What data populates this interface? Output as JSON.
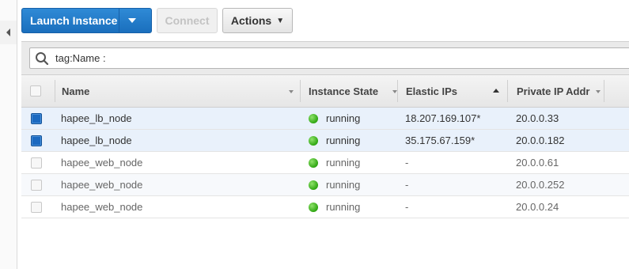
{
  "toolbar": {
    "launch_label": "Launch Instance",
    "connect_label": "Connect",
    "actions_label": "Actions"
  },
  "search": {
    "value": "tag:Name :"
  },
  "table": {
    "headers": {
      "name": "Name",
      "state": "Instance State",
      "elastic_ips": "Elastic IPs",
      "private_ip": "Private IP Addr"
    },
    "rows": [
      {
        "selected": true,
        "name": "hapee_lb_node",
        "state": "running",
        "elastic_ip": "18.207.169.107*",
        "private_ip": "20.0.0.33"
      },
      {
        "selected": true,
        "name": "hapee_lb_node",
        "state": "running",
        "elastic_ip": "35.175.67.159*",
        "private_ip": "20.0.0.182"
      },
      {
        "selected": false,
        "name": "hapee_web_node",
        "state": "running",
        "elastic_ip": "-",
        "private_ip": "20.0.0.61"
      },
      {
        "selected": false,
        "name": "hapee_web_node",
        "state": "running",
        "elastic_ip": "-",
        "private_ip": "20.0.0.252"
      },
      {
        "selected": false,
        "name": "hapee_web_node",
        "state": "running",
        "elastic_ip": "-",
        "private_ip": "20.0.0.24"
      }
    ]
  },
  "colors": {
    "primary": "#1a6fbd",
    "running": "#2fa612",
    "selected_row": "#e9f1fb"
  }
}
